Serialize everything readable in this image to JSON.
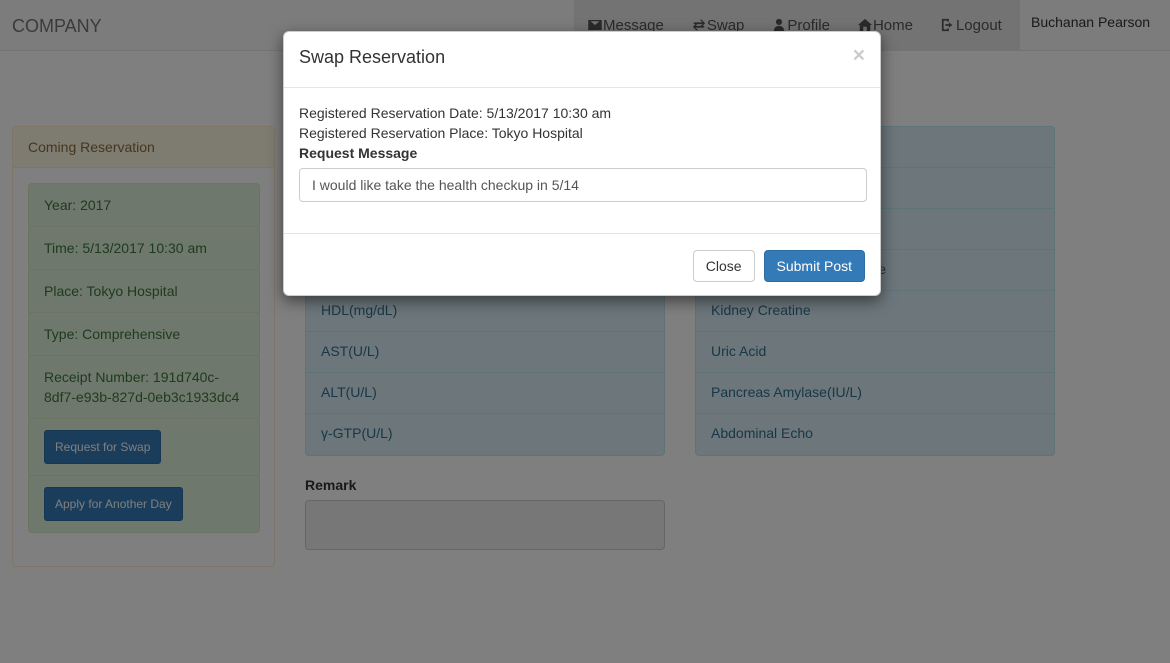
{
  "navbar": {
    "brand": "COMPANY",
    "items": [
      {
        "label": "Message",
        "icon": "envelope-icon"
      },
      {
        "label": "Swap",
        "icon": "swap-icon"
      },
      {
        "label": "Profile",
        "icon": "user-icon"
      },
      {
        "label": "Home",
        "icon": "home-icon"
      },
      {
        "label": "Logout",
        "icon": "logout-icon"
      }
    ],
    "user": "Buchanan Pearson"
  },
  "coming": {
    "title": "Coming Reservation",
    "year": "Year: 2017",
    "time": "Time: 5/13/2017 10:30 am",
    "place": "Place: Tokyo Hospital",
    "type": "Type: Comprehensive",
    "receipt": "Receipt Number: 191d740c-8df7-e93b-827d-0eb3c1933dc4",
    "swap_button": "Request for Swap",
    "apply_button": "Apply for Another Day"
  },
  "tests_left": [
    "HDL(mg/dL)",
    "AST(U/L)",
    "ALT(U/L)",
    "γ-GTP(U/L)"
  ],
  "tests_right_partial": "e",
  "tests_right": [
    "Kidney Creatine",
    "Uric Acid",
    "Pancreas Amylase(IU/L)",
    "Abdominal Echo"
  ],
  "remark": {
    "label": "Remark"
  },
  "modal": {
    "title": "Swap Reservation",
    "close_glyph": "×",
    "reg_date": "Registered Reservation Date: 5/13/2017 10:30 am",
    "reg_place": "Registered Reservation Place: Tokyo Hospital",
    "request_label": "Request Message",
    "request_value": "I would like take the health checkup in 5/14",
    "close_button": "Close",
    "submit_button": "Submit Post"
  },
  "colors": {
    "primary": "#337ab7",
    "success_bg": "#dff0d8",
    "info_bg": "#d9edf7",
    "warning_bg": "#fcf8e3"
  }
}
